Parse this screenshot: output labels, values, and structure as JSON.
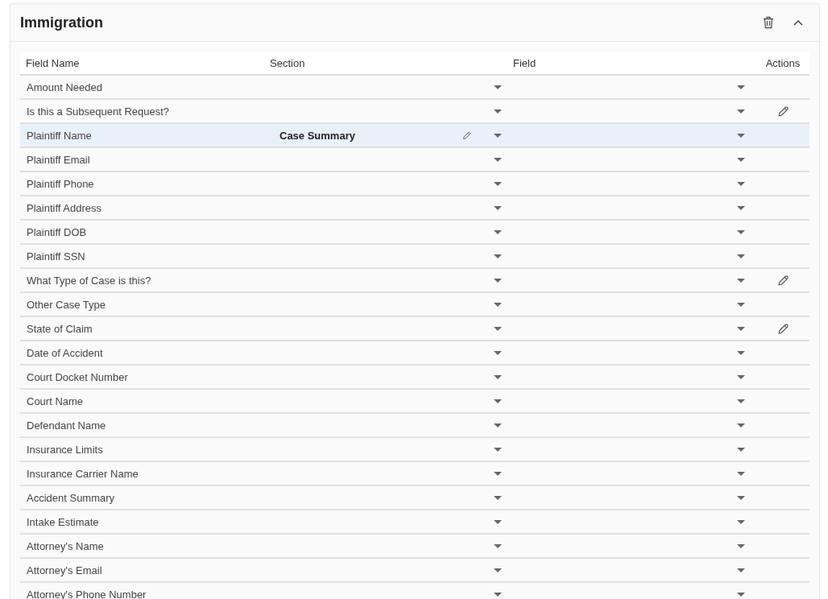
{
  "panel": {
    "title": "Immigration"
  },
  "table": {
    "columns": [
      "Field Name",
      "Section",
      "Field",
      "Actions"
    ],
    "rows": [
      {
        "field_name": "Amount Needed",
        "selected": false,
        "edit_action": false
      },
      {
        "field_name": "Is this a Subsequent Request?",
        "selected": false,
        "edit_action": true
      },
      {
        "field_name": "Plaintiff Name",
        "section": "Case Summary",
        "selected": true,
        "edit_action": false
      },
      {
        "field_name": "Plaintiff Email",
        "selected": false,
        "edit_action": false
      },
      {
        "field_name": "Plaintiff Phone",
        "selected": false,
        "edit_action": false
      },
      {
        "field_name": "Plaintiff Address",
        "selected": false,
        "edit_action": false
      },
      {
        "field_name": "Plaintiff DOB",
        "selected": false,
        "edit_action": false
      },
      {
        "field_name": "Plaintiff SSN",
        "selected": false,
        "edit_action": false
      },
      {
        "field_name": "What Type of Case is this?",
        "selected": false,
        "edit_action": true
      },
      {
        "field_name": "Other Case Type",
        "selected": false,
        "edit_action": false
      },
      {
        "field_name": "State of Claim",
        "selected": false,
        "edit_action": true
      },
      {
        "field_name": "Date of Accident",
        "selected": false,
        "edit_action": false
      },
      {
        "field_name": "Court Docket Number",
        "selected": false,
        "edit_action": false
      },
      {
        "field_name": "Court Name",
        "selected": false,
        "edit_action": false
      },
      {
        "field_name": "Defendant Name",
        "selected": false,
        "edit_action": false
      },
      {
        "field_name": "Insurance Limits",
        "selected": false,
        "edit_action": false
      },
      {
        "field_name": "Insurance Carrier Name",
        "selected": false,
        "edit_action": false
      },
      {
        "field_name": "Accident Summary",
        "selected": false,
        "edit_action": false
      },
      {
        "field_name": "Intake Estimate",
        "selected": false,
        "edit_action": false
      },
      {
        "field_name": "Attorney's Name",
        "selected": false,
        "edit_action": false
      },
      {
        "field_name": "Attorney's Email",
        "selected": false,
        "edit_action": false
      },
      {
        "field_name": "Attorney's Phone Number",
        "selected": false,
        "edit_action": false
      }
    ]
  }
}
